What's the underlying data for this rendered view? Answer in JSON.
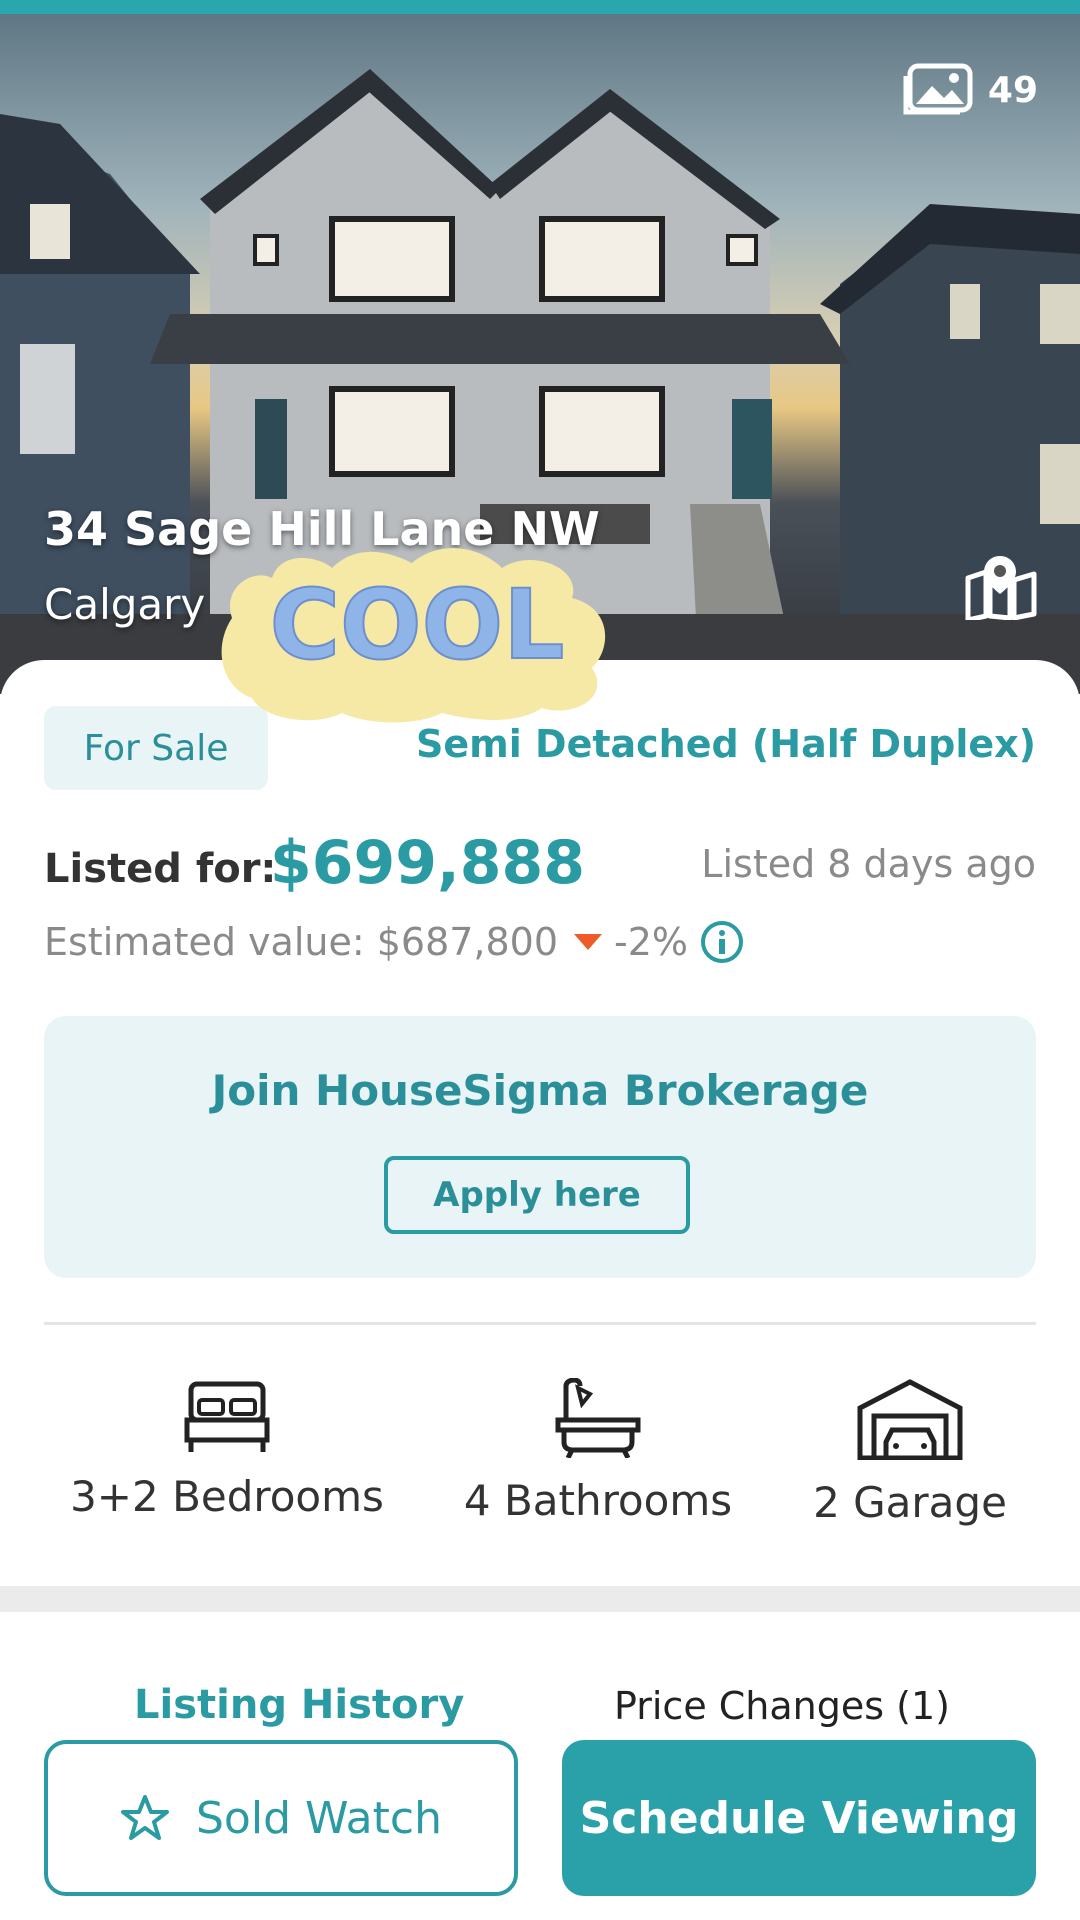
{
  "hero": {
    "photo_count": "49",
    "address_line1": "34 Sage Hill Lane NW",
    "address_city": "Calgary"
  },
  "sticker": {
    "text": "COOL"
  },
  "listing": {
    "status_badge": "For Sale",
    "property_type": "Semi Detached (Half Duplex)",
    "listed_for_label": "Listed for:",
    "price": "$699,888",
    "listed_ago": "Listed 8 days ago",
    "estimated_label": "Estimated value: $687,800",
    "estimated_change": "-2%"
  },
  "brokerage": {
    "title": "Join HouseSigma Brokerage",
    "apply_label": "Apply here"
  },
  "features": {
    "bedrooms": "3+2 Bedrooms",
    "bathrooms": "4 Bathrooms",
    "garage": "2 Garage"
  },
  "tabs": {
    "history": "Listing History",
    "price_changes": "Price Changes (1)"
  },
  "actions": {
    "sold_watch": "Sold Watch",
    "schedule": "Schedule Viewing"
  },
  "colors": {
    "accent": "#2aa6ae",
    "decrease": "#f05a28"
  }
}
